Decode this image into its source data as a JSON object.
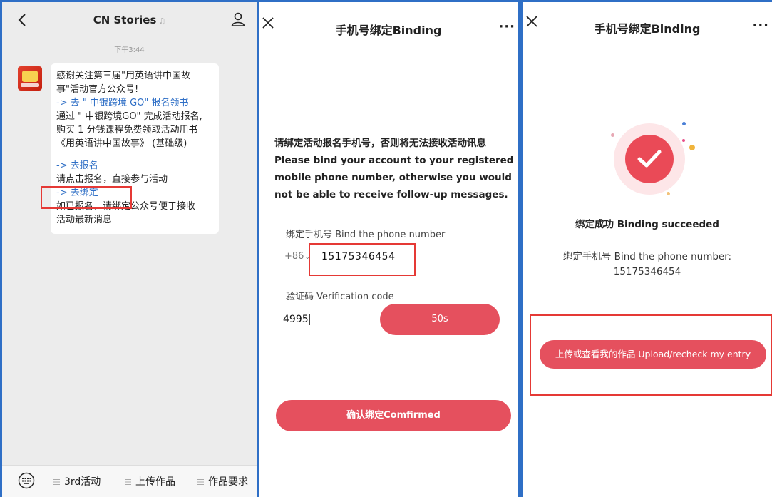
{
  "chat": {
    "title": "CN Stories",
    "mute_mark": "♫",
    "time": "下午3:44",
    "message_lines": [
      "感谢关注第三届\"用英语讲中国故",
      "事\"活动官方公众号!"
    ],
    "link_go": "-> 去 \" 中银跨境 GO\" 报名领书",
    "body_lines": [
      "通过 \" 中银跨境GO\" 完成活动报名,",
      "购买 1 分钱课程免费领取活动用书",
      "《用英语讲中国故事》 (基础级)"
    ],
    "link_signup": "-> 去报名",
    "signup_tip": "请点击报名，直接参与活动",
    "link_bind": "-> 去绑定",
    "bind_tip_lines": [
      "如已报名，请绑定公众号便于接收",
      "活动最新消息"
    ],
    "menu": [
      "3rd活动",
      "上传作品",
      "作品要求"
    ]
  },
  "binding": {
    "title": "手机号绑定Binding",
    "more": "···",
    "notice_lines": [
      "请绑定活动报名手机号，否则将无法接收活动讯息",
      "Please bind your account to your registered",
      "mobile phone number, otherwise you would",
      "not be able to receive follow-up messages."
    ],
    "phone_label": "绑定手机号 Bind the phone number",
    "prefix": "+86",
    "phone": "15175346454",
    "code_label": "验证码 Verification code",
    "code": "4995",
    "countdown": "50s",
    "confirm": "确认绑定Comfirmed"
  },
  "success": {
    "title": "手机号绑定Binding",
    "more": "···",
    "message": "绑定成功 Binding succeeded",
    "bound_label": "绑定手机号 Bind the phone number:",
    "bound_number": "15175346454",
    "upload": "上传或查看我的作品 Upload/recheck my entry"
  },
  "colors": {
    "accent": "#e5505e",
    "frame": "#2f6fc6",
    "highlight": "#e53935",
    "link": "#2f6fc6"
  }
}
